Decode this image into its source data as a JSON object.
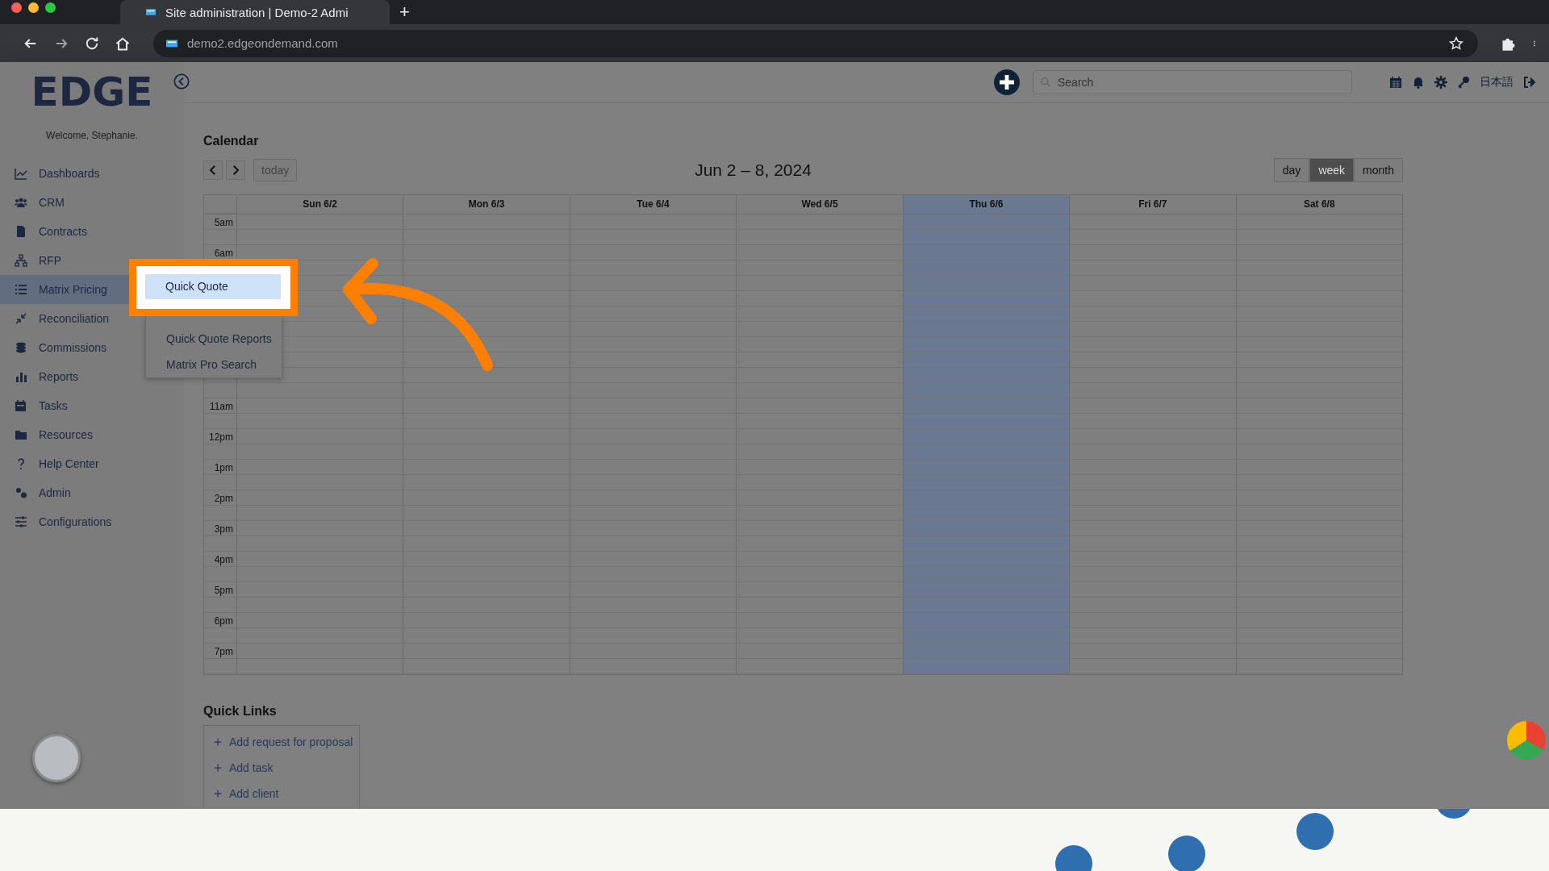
{
  "browser": {
    "tab_title": "Site administration | Demo-2 Admi",
    "new_tab": "+",
    "url": "demo2.edgeondemand.com"
  },
  "app": {
    "logo": "EDGE",
    "welcome": "Welcome, Stephanie.",
    "search": {
      "placeholder": "Search"
    },
    "language": "日本語"
  },
  "sidebar": {
    "items": [
      {
        "label": "Dashboards",
        "selected": false
      },
      {
        "label": "CRM",
        "selected": false
      },
      {
        "label": "Contracts",
        "selected": false
      },
      {
        "label": "RFP",
        "selected": false
      },
      {
        "label": "Matrix Pricing",
        "selected": true
      },
      {
        "label": "Reconciliation",
        "selected": false
      },
      {
        "label": "Commissions",
        "selected": false
      },
      {
        "label": "Reports",
        "selected": false
      },
      {
        "label": "Tasks",
        "selected": false
      },
      {
        "label": "Resources",
        "selected": false
      },
      {
        "label": "Help Center",
        "selected": false
      },
      {
        "label": "Admin",
        "selected": false
      },
      {
        "label": "Configurations",
        "selected": false
      }
    ]
  },
  "submenu": {
    "items": [
      {
        "kind": "item",
        "label": "Quick Quote",
        "selected": true
      },
      {
        "kind": "item",
        "label": "Quick Quote Reports",
        "selected": false
      },
      {
        "kind": "item",
        "label": "Matrix Pro Search",
        "selected": false
      }
    ]
  },
  "calendar": {
    "title": "Calendar",
    "today_button": "today",
    "range": "Jun 2 – 8, 2024",
    "views": [
      {
        "label": "day",
        "selected": false
      },
      {
        "label": "week",
        "selected": true
      },
      {
        "label": "month",
        "selected": false
      }
    ],
    "days": [
      {
        "label": "Sun 6/2",
        "today": false
      },
      {
        "label": "Mon 6/3",
        "today": false
      },
      {
        "label": "Tue 6/4",
        "today": false
      },
      {
        "label": "Wed 6/5",
        "today": false
      },
      {
        "label": "Thu 6/6",
        "today": true
      },
      {
        "label": "Fri 6/7",
        "today": false
      },
      {
        "label": "Sat 6/8",
        "today": false
      }
    ],
    "time_slots": [
      {
        "kind": "hour",
        "label": "5am"
      },
      {
        "kind": "hour",
        "label": "6am"
      },
      {
        "kind": "covered"
      },
      {
        "kind": "covered"
      },
      {
        "kind": "covered"
      },
      {
        "kind": "covered"
      },
      {
        "kind": "hour",
        "label": "11am"
      },
      {
        "kind": "hour",
        "label": "12pm"
      },
      {
        "kind": "hour",
        "label": "1pm"
      },
      {
        "kind": "hour",
        "label": "2pm"
      },
      {
        "kind": "hour",
        "label": "3pm"
      },
      {
        "kind": "hour",
        "label": "4pm"
      },
      {
        "kind": "hour",
        "label": "5pm"
      },
      {
        "kind": "hour",
        "label": "6pm"
      },
      {
        "kind": "hour",
        "label": "7pm"
      }
    ]
  },
  "quick_links": {
    "title": "Quick Links",
    "items": [
      {
        "label": "Add request for proposal"
      },
      {
        "label": "Add task"
      },
      {
        "label": "Add client"
      }
    ]
  }
}
